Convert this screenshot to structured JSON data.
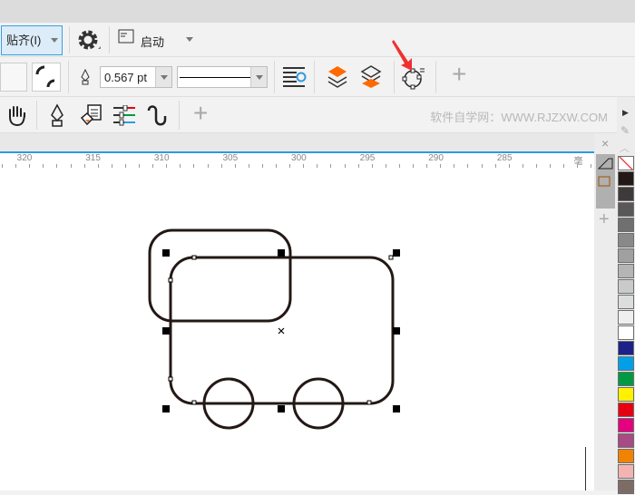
{
  "toolbar1": {
    "snap_label": "贴齐(I)",
    "launch_label": "启动"
  },
  "toolbar2": {
    "outline_width": "0.567 pt"
  },
  "toolbar3": {
    "watermark": "软件自学网：WWW.RJZXW.COM"
  },
  "ruler": {
    "ticks": [
      "320",
      "315",
      "310",
      "305",
      "300",
      "295",
      "290",
      "285"
    ],
    "unit": "毫米"
  },
  "palette": {
    "colors": [
      "#231815",
      "#3e3a39",
      "#595757",
      "#717071",
      "#898989",
      "#9fa0a0",
      "#b5b5b6",
      "#c9caca",
      "#dcdddd",
      "#efefef",
      "#ffffff",
      "#1d2088",
      "#00a0e9",
      "#009944",
      "#fff100",
      "#e60012",
      "#e4007f",
      "#a84a83",
      "#f08300",
      "#f3b4b1",
      "#7d6c66"
    ]
  },
  "accent": {
    "arrow": "#f03030",
    "layer": "#ff6a00",
    "ruler": "#2c9be0"
  }
}
